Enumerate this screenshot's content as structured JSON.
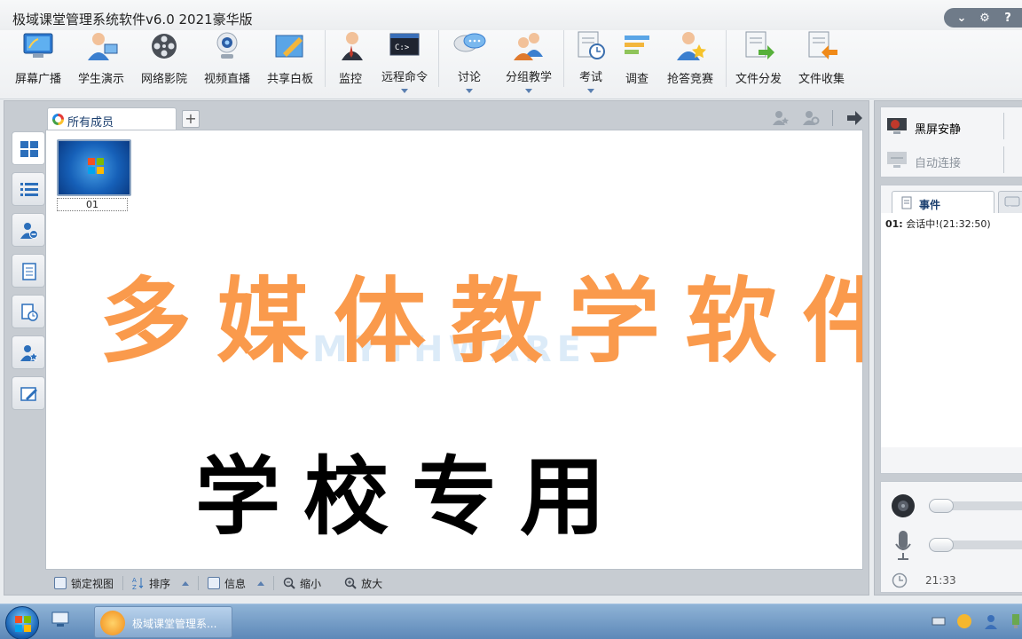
{
  "app": {
    "title": "极域课堂管理系统软件v6.0 2021豪华版"
  },
  "toolbar": {
    "items": [
      {
        "label": "屏幕广播",
        "icon": "screen-broadcast-icon"
      },
      {
        "label": "学生演示",
        "icon": "student-demo-icon"
      },
      {
        "label": "网络影院",
        "icon": "film-reel-icon"
      },
      {
        "label": "视频直播",
        "icon": "webcam-icon"
      },
      {
        "label": "共享白板",
        "icon": "whiteboard-icon"
      },
      {
        "label": "监控",
        "icon": "monitor-person-icon"
      },
      {
        "label": "远程命令",
        "icon": "command-prompt-icon"
      },
      {
        "label": "讨论",
        "icon": "chat-bubbles-icon"
      },
      {
        "label": "分组教学",
        "icon": "group-teaching-icon"
      },
      {
        "label": "考试",
        "icon": "exam-clock-icon"
      },
      {
        "label": "调查",
        "icon": "survey-bars-icon"
      },
      {
        "label": "抢答竞赛",
        "icon": "quiz-star-icon"
      },
      {
        "label": "文件分发",
        "icon": "file-send-icon"
      },
      {
        "label": "文件收集",
        "icon": "file-collect-icon"
      }
    ]
  },
  "tabs": {
    "all_members": "所有成员"
  },
  "members": [
    {
      "name": "01"
    }
  ],
  "overlay": {
    "headline": "多媒体教学软件",
    "subline": "学校专用"
  },
  "bottom_bar": {
    "lock_view": "锁定视图",
    "sort": "排序",
    "info": "信息",
    "zoom_out": "缩小",
    "zoom_in": "放大"
  },
  "quick_actions": {
    "black_screen": "黑屏安静",
    "auto_connect": "自动连接"
  },
  "events": {
    "tab_label": "事件",
    "lines": [
      {
        "id": "01:",
        "text": "会话中!(21:32:50)"
      }
    ]
  },
  "media": {
    "time": "21:33"
  },
  "taskbar": {
    "app_label": "极域课堂管理系..."
  },
  "colors": {
    "headline": "#fa9a4c",
    "subline": "#000000",
    "accent": "#1a3e6e"
  }
}
